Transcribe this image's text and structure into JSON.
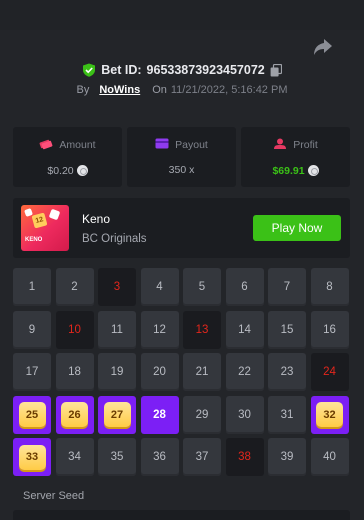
{
  "bet": {
    "id_label": "Bet ID:",
    "id": "96533873923457072",
    "by_label": "By",
    "user": "NoWins",
    "on_label": "On",
    "date": "11/21/2022, 5:16:42 PM"
  },
  "stats": {
    "amount": {
      "label": "Amount",
      "value": "$0.20"
    },
    "payout": {
      "label": "Payout",
      "value": "350 x"
    },
    "profit": {
      "label": "Profit",
      "value": "$69.91"
    }
  },
  "game": {
    "name": "Keno",
    "category": "BC Originals",
    "thumb_label": "KENO",
    "thumb_tile": "12",
    "play_label": "Play Now"
  },
  "board": {
    "cells": [
      {
        "n": "1",
        "state": "normal"
      },
      {
        "n": "2",
        "state": "normal"
      },
      {
        "n": "3",
        "state": "drawn"
      },
      {
        "n": "4",
        "state": "normal"
      },
      {
        "n": "5",
        "state": "normal"
      },
      {
        "n": "6",
        "state": "normal"
      },
      {
        "n": "7",
        "state": "normal"
      },
      {
        "n": "8",
        "state": "normal"
      },
      {
        "n": "9",
        "state": "normal"
      },
      {
        "n": "10",
        "state": "drawn"
      },
      {
        "n": "11",
        "state": "normal"
      },
      {
        "n": "12",
        "state": "normal"
      },
      {
        "n": "13",
        "state": "drawn"
      },
      {
        "n": "14",
        "state": "normal"
      },
      {
        "n": "15",
        "state": "normal"
      },
      {
        "n": "16",
        "state": "normal"
      },
      {
        "n": "17",
        "state": "normal"
      },
      {
        "n": "18",
        "state": "normal"
      },
      {
        "n": "19",
        "state": "normal"
      },
      {
        "n": "20",
        "state": "normal"
      },
      {
        "n": "21",
        "state": "normal"
      },
      {
        "n": "22",
        "state": "normal"
      },
      {
        "n": "23",
        "state": "normal"
      },
      {
        "n": "24",
        "state": "drawn"
      },
      {
        "n": "25",
        "state": "hit"
      },
      {
        "n": "26",
        "state": "hit"
      },
      {
        "n": "27",
        "state": "hit"
      },
      {
        "n": "28",
        "state": "picked"
      },
      {
        "n": "29",
        "state": "normal"
      },
      {
        "n": "30",
        "state": "normal"
      },
      {
        "n": "31",
        "state": "normal"
      },
      {
        "n": "32",
        "state": "hit"
      },
      {
        "n": "33",
        "state": "hit"
      },
      {
        "n": "34",
        "state": "normal"
      },
      {
        "n": "35",
        "state": "normal"
      },
      {
        "n": "36",
        "state": "normal"
      },
      {
        "n": "37",
        "state": "normal"
      },
      {
        "n": "38",
        "state": "drawn"
      },
      {
        "n": "39",
        "state": "normal"
      },
      {
        "n": "40",
        "state": "normal"
      }
    ]
  },
  "seed": {
    "label": "Server Seed"
  },
  "colors": {
    "accent_green": "#3bc117",
    "picked_purple": "#7c1ff5",
    "drawn_red": "#e3261c",
    "gem_yellow": "#ffcc46"
  },
  "icons": {
    "share": "share-icon",
    "verified": "shield-check-icon",
    "copy": "copy-icon",
    "amount": "money-icon",
    "payout": "card-icon",
    "profit": "profit-icon",
    "coin": "coin-icon"
  }
}
